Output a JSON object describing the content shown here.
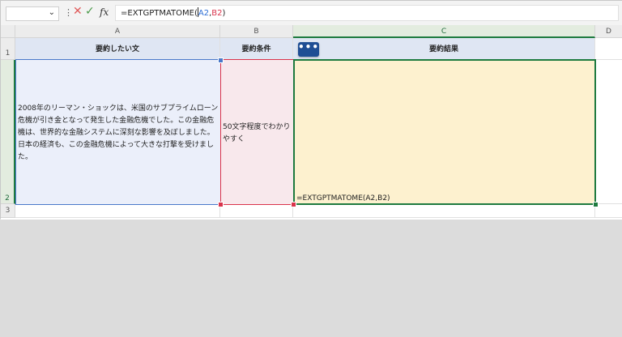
{
  "formula_bar": {
    "formula_prefix": "=EXTGPTMATOME(",
    "ref_a": "A2",
    "comma": ",",
    "ref_b": "B2",
    "formula_suffix": ")",
    "fx_label": "fx",
    "cancel_symbol": "✕",
    "enter_symbol": "✓",
    "kebab_symbol": "⋮",
    "namebox_chevron": "⌄"
  },
  "columns": [
    "A",
    "B",
    "C",
    "D"
  ],
  "rows": [
    "1",
    "2",
    "3"
  ],
  "cells": {
    "A1": "要約したい文",
    "B1": "要約条件",
    "C1": "要約結果",
    "A2": "2008年のリーマン・ショックは、米国のサブプライムローン危機が引き金となって発生した金融危機でした。この金融危機は、世界的な金融システムに深刻な影響を及ぼしました。日本の経済も、この金融危機によって大きな打撃を受けました。",
    "B2": "50文字程度でわかりやすく",
    "C2": "=EXTGPTMATOME(A2,B2)"
  },
  "copilot_button": {
    "label": "•••"
  },
  "colors": {
    "selection_green": "#1e7a3f",
    "ref_blue": "#4a79c9",
    "ref_red": "#d9334b",
    "header_fill": "#dfe6f3",
    "result_fill": "#fdf1cf"
  }
}
